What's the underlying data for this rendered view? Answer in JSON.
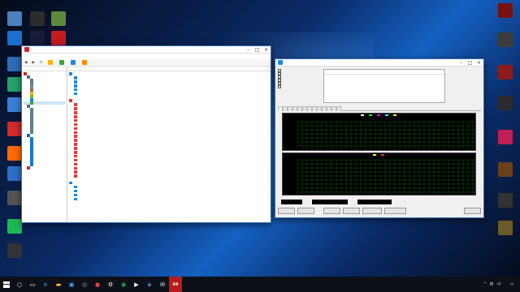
{
  "desktop": {
    "top_text": "",
    "left_icons": [
      {
        "label": "",
        "color": "#4a7fc1"
      },
      {
        "label": "",
        "color": "#2c2c2c"
      },
      {
        "label": "",
        "color": "#5c8a3a"
      },
      {
        "label": "",
        "color": "#1a6fd0"
      },
      {
        "label": "",
        "color": "#1a1a3a"
      },
      {
        "label": "",
        "color": "#c51b23"
      },
      {
        "label": "",
        "color": "#2d6db5"
      },
      {
        "label": "",
        "color": "#26a269"
      },
      {
        "label": "",
        "color": "#3b80d6"
      },
      {
        "label": "",
        "color": "#d02c2c"
      },
      {
        "label": "",
        "color": "#ff6a00"
      },
      {
        "label": "",
        "color": "#2f6fc9"
      },
      {
        "label": "",
        "color": "#555"
      },
      {
        "label": "",
        "color": "#1db954"
      },
      {
        "label": "",
        "color": "#333"
      }
    ],
    "right_icons": [
      {
        "label": "",
        "color": "#7a1010"
      },
      {
        "label": "",
        "color": "#3c3c3c"
      },
      {
        "label": "",
        "color": "#8c1c1c"
      },
      {
        "label": "",
        "color": "#2b2b2b"
      },
      {
        "label": "",
        "color": "#c21e56"
      },
      {
        "label": "",
        "color": "#6b3f1a"
      },
      {
        "label": "",
        "color": "#333"
      },
      {
        "label": "",
        "color": "#6a5a2a"
      }
    ]
  },
  "aida": {
    "title": "",
    "menu": [
      "",
      "",
      "",
      "",
      "",
      ""
    ],
    "toolbar": [
      "",
      "",
      "",
      ""
    ],
    "left_tabs": [
      "",
      ""
    ],
    "col_headers": [
      "",
      ""
    ],
    "tree": [
      {
        "label": "",
        "level": 0,
        "color": "#c62828"
      },
      {
        "label": "",
        "level": 1,
        "color": "#546e7a"
      },
      {
        "label": "",
        "level": 2,
        "color": "#607d8b"
      },
      {
        "label": "",
        "level": 2,
        "color": "#607d8b"
      },
      {
        "label": "",
        "level": 2,
        "color": "#78909c"
      },
      {
        "label": "",
        "level": 2,
        "color": "#8d6e63"
      },
      {
        "label": "",
        "level": 2,
        "color": "#f9a825"
      },
      {
        "label": "",
        "level": 2,
        "color": "#7cb342"
      },
      {
        "label": "",
        "level": 2,
        "color": "#1e88e5"
      },
      {
        "label": "",
        "level": 2,
        "color": "#43a047",
        "selected": true
      },
      {
        "label": "",
        "level": 1,
        "color": "#546e7a"
      },
      {
        "label": "",
        "level": 2,
        "color": "#607d8b"
      },
      {
        "label": "",
        "level": 2,
        "color": "#607d8b"
      },
      {
        "label": "",
        "level": 2,
        "color": "#607d8b"
      },
      {
        "label": "",
        "level": 2,
        "color": "#607d8b"
      },
      {
        "label": "",
        "level": 2,
        "color": "#607d8b"
      },
      {
        "label": "",
        "level": 2,
        "color": "#607d8b"
      },
      {
        "label": "",
        "level": 2,
        "color": "#607d8b"
      },
      {
        "label": "",
        "level": 2,
        "color": "#607d8b"
      },
      {
        "label": "",
        "level": 1,
        "color": "#1565c0"
      },
      {
        "label": "",
        "level": 2,
        "color": "#1976d2"
      },
      {
        "label": "",
        "level": 2,
        "color": "#1976d2"
      },
      {
        "label": "",
        "level": 2,
        "color": "#1976d2"
      },
      {
        "label": "",
        "level": 2,
        "color": "#1976d2"
      },
      {
        "label": "",
        "level": 2,
        "color": "#1976d2"
      },
      {
        "label": "",
        "level": 2,
        "color": "#1976d2"
      },
      {
        "label": "",
        "level": 2,
        "color": "#1976d2"
      },
      {
        "label": "",
        "level": 2,
        "color": "#1976d2"
      },
      {
        "label": "",
        "level": 2,
        "color": "#1976d2"
      },
      {
        "label": "",
        "level": 1,
        "color": "#c62828"
      }
    ],
    "groups": [
      {
        "name": "",
        "color": "#1e88e5",
        "rows": [
          {
            "field": "",
            "value": ""
          },
          {
            "field": "",
            "value": ""
          },
          {
            "field": "",
            "value": ""
          },
          {
            "field": "",
            "value": ""
          },
          {
            "field": "",
            "value": ""
          }
        ]
      },
      {
        "name": "",
        "color": "#e53935",
        "rows": [
          {
            "field": "",
            "value": ""
          },
          {
            "field": "",
            "value": ""
          },
          {
            "field": "",
            "value": ""
          },
          {
            "field": "",
            "value": ""
          },
          {
            "field": "",
            "value": ""
          },
          {
            "field": "",
            "value": ""
          },
          {
            "field": "",
            "value": ""
          },
          {
            "field": "",
            "value": ""
          },
          {
            "field": "",
            "value": ""
          },
          {
            "field": "",
            "value": ""
          },
          {
            "field": "",
            "value": ""
          },
          {
            "field": "",
            "value": ""
          },
          {
            "field": "",
            "value": ""
          },
          {
            "field": "",
            "value": ""
          },
          {
            "field": "",
            "value": ""
          },
          {
            "field": "",
            "value": ""
          },
          {
            "field": "",
            "value": ""
          },
          {
            "field": "",
            "value": ""
          },
          {
            "field": "",
            "value": ""
          }
        ]
      },
      {
        "name": "",
        "color": "#1e88e5",
        "rows": [
          {
            "field": "",
            "value": ""
          },
          {
            "field": "",
            "value": ""
          },
          {
            "field": "",
            "value": ""
          },
          {
            "field": "",
            "value": ""
          }
        ]
      }
    ]
  },
  "stability": {
    "title": "",
    "checks": [
      {
        "label": "",
        "checked": false
      },
      {
        "label": "",
        "checked": true
      },
      {
        "label": "",
        "checked": false
      },
      {
        "label": "",
        "checked": false
      },
      {
        "label": "",
        "checked": false
      },
      {
        "label": "",
        "checked": false
      }
    ],
    "log_headers": [
      "",
      ""
    ],
    "tabs": [
      "",
      "",
      "",
      "",
      "",
      "",
      "",
      "",
      "",
      "",
      "",
      "",
      ""
    ],
    "temp_legend": [
      {
        "name": "",
        "color": "#ffffff"
      },
      {
        "name": "",
        "color": "#00ff00"
      },
      {
        "name": "",
        "color": "#ff00ff"
      },
      {
        "name": "",
        "color": "#00ffff"
      },
      {
        "name": "",
        "color": "#ffff00"
      }
    ],
    "temp_sublegend": "",
    "temp_ymax": "",
    "temp_ymin": "",
    "cpu_legend": [
      {
        "name": "",
        "color": "#ffff00"
      },
      {
        "name": "",
        "color": "#ff3030"
      }
    ],
    "cpu_ymax": "",
    "cpu_ymin": "",
    "watermark": "",
    "remaining_battery_label": "",
    "battery_value": "",
    "test_started_label": "",
    "elapsed_time_label": "",
    "buttons": [
      "",
      "",
      "",
      "",
      "",
      "",
      ""
    ]
  },
  "taskbar": {
    "tray_lang": "",
    "time": "",
    "date": ""
  }
}
